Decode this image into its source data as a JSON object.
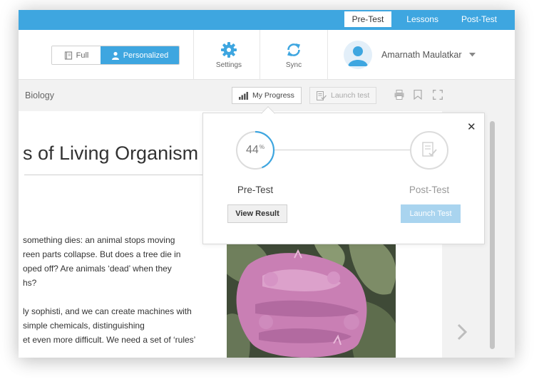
{
  "topnav": {
    "tabs": [
      {
        "label": "Pre-Test",
        "active": true
      },
      {
        "label": "Lessons",
        "active": false
      },
      {
        "label": "Post-Test",
        "active": false
      }
    ]
  },
  "header": {
    "view_toggle": {
      "full_label": "Full",
      "personalized_label": "Personalized",
      "selected": "Personalized"
    },
    "settings_label": "Settings",
    "sync_label": "Sync",
    "user_name": "Amarnath Maulatkar"
  },
  "subbar": {
    "breadcrumb": "Biology",
    "my_progress_label": "My Progress",
    "launch_test_label": "Launch test"
  },
  "content": {
    "title": "s of Living Organism",
    "paragraphs": [
      [
        "something dies: an animal stops moving",
        "reen parts collapse. But does a tree die in",
        "oped off? Are animals ‘dead’ when they",
        "hs?"
      ],
      [
        "ly sophisti, and we can create machines with",
        "simple chemicals, distinguishing",
        "et even more difficult. We need a set of ‘rules’"
      ]
    ]
  },
  "progress_popup": {
    "pre_test": {
      "label": "Pre-Test",
      "percent": 44,
      "button": "View Result"
    },
    "post_test": {
      "label": "Post-Test",
      "button": "Launch Test"
    }
  },
  "colors": {
    "accent": "#3ea6e0",
    "toolbar_grey": "#f2f2f2",
    "disabled_button": "#a9d4ef"
  }
}
